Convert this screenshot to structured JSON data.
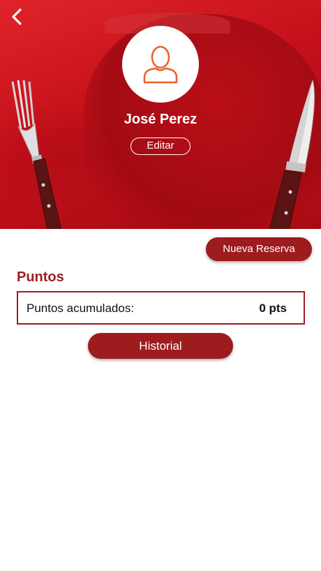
{
  "header": {
    "back_icon": "chevron-left-icon"
  },
  "profile": {
    "avatar_icon": "user-outline-icon",
    "name": "José Perez",
    "edit_label": "Editar"
  },
  "actions": {
    "new_reservation_label": "Nueva Reserva",
    "history_label": "Historial"
  },
  "points": {
    "section_title": "Puntos",
    "label": "Puntos acumulados:",
    "value": "0 pts"
  },
  "colors": {
    "accent": "#9e1b1e",
    "hero_red": "#c4101a",
    "avatar_icon": "#e8642a"
  },
  "decorations": {
    "left_utensil": "fork-icon",
    "right_utensil": "knife-icon"
  }
}
